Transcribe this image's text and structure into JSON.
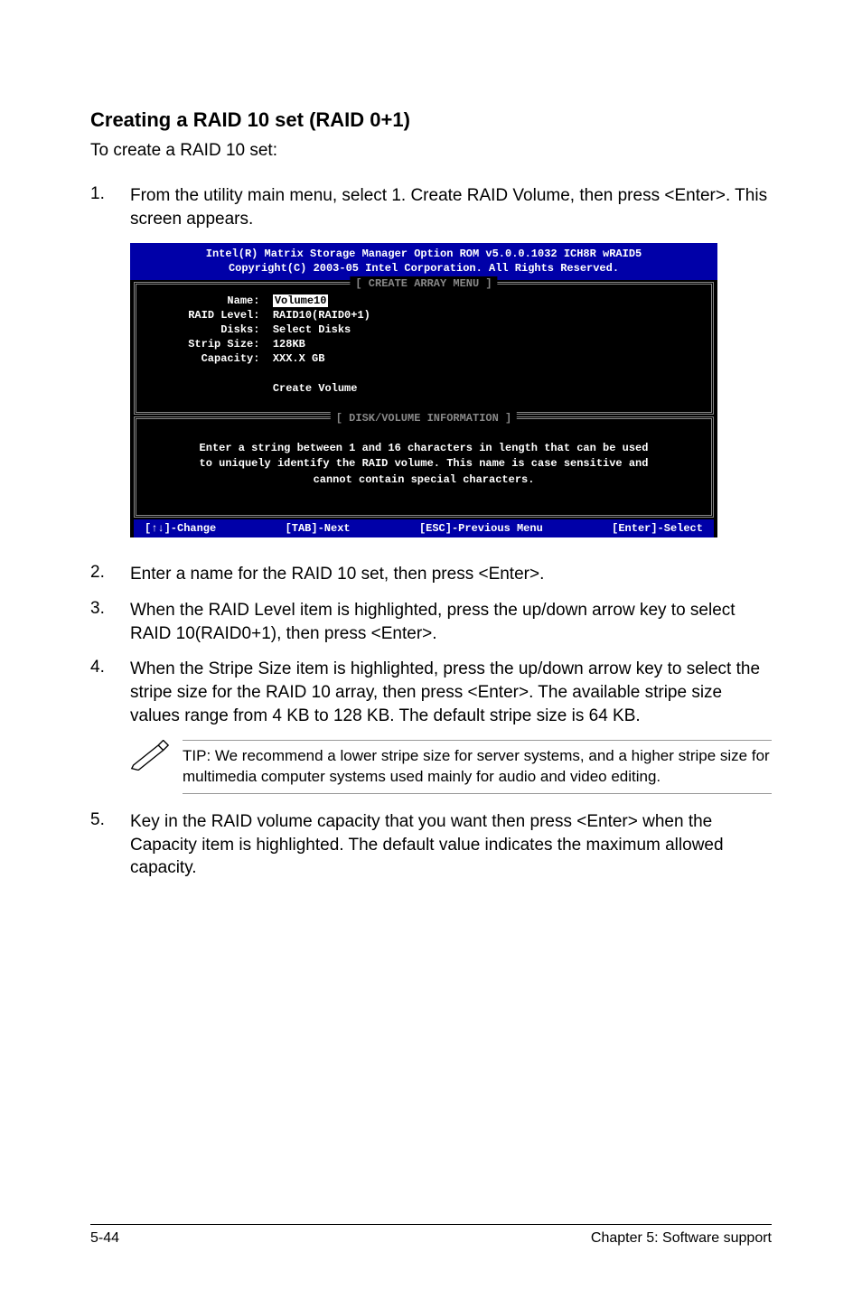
{
  "heading": "Creating a RAID 10 set (RAID 0+1)",
  "intro": "To create a RAID 10 set:",
  "steps": {
    "s1": {
      "n": "1.",
      "t": "From the utility main menu, select 1. Create RAID Volume, then press <Enter>. This screen appears."
    },
    "s2": {
      "n": "2.",
      "t": "Enter a name for the RAID 10 set, then press <Enter>."
    },
    "s3": {
      "n": "3.",
      "t": "When the RAID Level item is highlighted, press the up/down arrow key to select RAID 10(RAID0+1), then press <Enter>."
    },
    "s4": {
      "n": "4.",
      "t": "When the Stripe Size item is highlighted, press the up/down arrow key to select the stripe size for the RAID 10 array, then press <Enter>. The available stripe size values range from 4 KB to 128 KB. The default stripe size is 64 KB."
    },
    "s5": {
      "n": "5.",
      "t": "Key in the RAID volume capacity that you want then press <Enter> when the Capacity item is highlighted. The default value indicates the maximum allowed capacity."
    }
  },
  "note": "TIP: We recommend a lower stripe size for server systems, and a higher stripe size for multimedia computer systems used mainly for audio and video editing.",
  "bios": {
    "header1": "Intel(R) Matrix Storage Manager Option ROM v5.0.0.1032 ICH8R wRAID5",
    "header2": "Copyright(C) 2003-05 Intel Corporation. All Rights Reserved.",
    "panel1_title": "[ CREATE ARRAY MENU ]",
    "name_l": "Name:",
    "name_v": "Volume10",
    "raid_l": "RAID Level:",
    "raid_v": "RAID10(RAID0+1)",
    "disks_l": "Disks:",
    "disks_v": "Select Disks",
    "strip_l": "Strip Size:",
    "strip_v": "128KB",
    "cap_l": "Capacity:",
    "cap_v": "XXX.X GB",
    "create": "Create Volume",
    "panel2_title": "[ DISK/VOLUME INFORMATION ]",
    "info1": "Enter a string between 1 and 16 characters in length that can be used",
    "info2": "to uniquely identify the RAID volume. This name is case sensitive and",
    "info3": "cannot contain special characters.",
    "foot1": "[↑↓]-Change",
    "foot2": "[TAB]-Next",
    "foot3": "[ESC]-Previous Menu",
    "foot4": "[Enter]-Select"
  },
  "footer": {
    "left": "5-44",
    "right": "Chapter 5: Software support"
  }
}
